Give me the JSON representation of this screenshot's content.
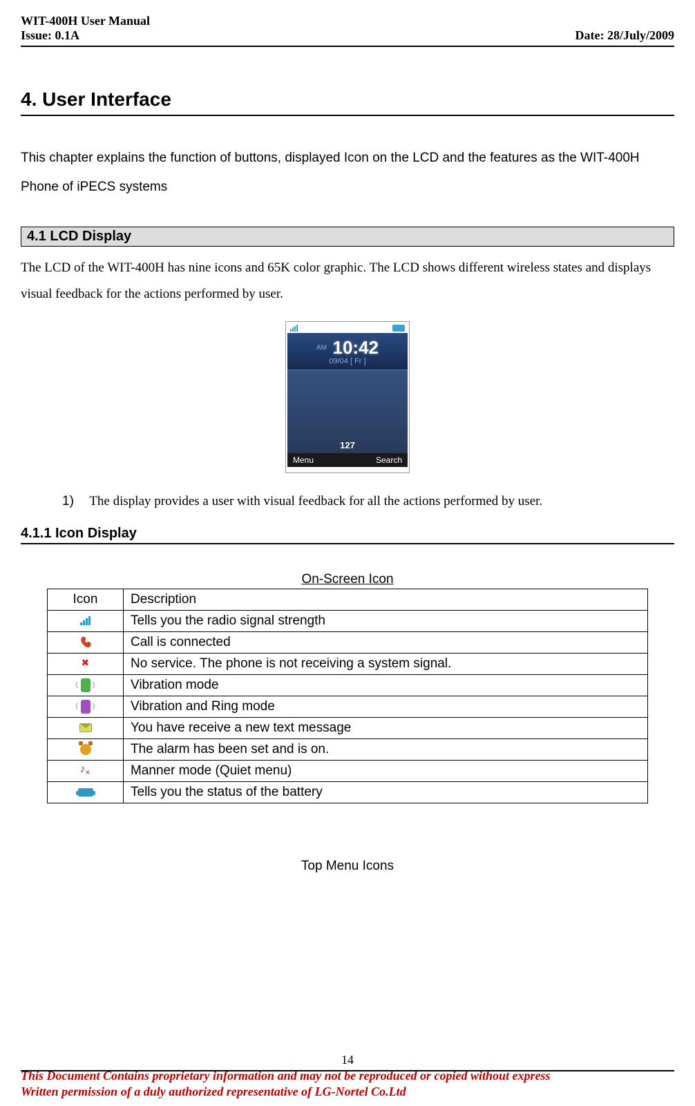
{
  "header": {
    "title": "WIT-400H User Manual",
    "issue": "Issue: 0.1A",
    "date": "Date: 28/July/2009"
  },
  "chapter": {
    "number_title": "4.       User Interface",
    "intro": "This chapter explains the function of buttons, displayed Icon on the LCD and the features as the WIT-400H Phone of iPECS systems"
  },
  "section41": {
    "title": "4.1         LCD Display",
    "text": "The LCD of the WIT-400H has nine icons and 65K color graphic. The LCD shows different wireless states and displays visual feedback for the actions performed by user."
  },
  "phone_screen": {
    "am": "AM",
    "time": "10:42",
    "date": "09/04 [ Fr ]",
    "station": "127",
    "softkey_left": "Menu",
    "softkey_right": "Search"
  },
  "list_item_1": {
    "num": "1)",
    "text": "The display provides a user with visual feedback for all the actions performed by user."
  },
  "section411": {
    "title": "4.1.1     Icon Display"
  },
  "table1": {
    "caption": "On-Screen Icon",
    "headers": {
      "icon": "Icon",
      "desc": "Description"
    },
    "rows": [
      {
        "desc": "Tells you the radio signal strength",
        "icon": "signal-icon"
      },
      {
        "desc": "Call is connected",
        "icon": "call-icon"
      },
      {
        "desc": "No service. The phone is not receiving a system signal.",
        "icon": "no-service-icon"
      },
      {
        "desc": "Vibration mode",
        "icon": "vibration-icon"
      },
      {
        "desc": "Vibration and Ring mode",
        "icon": "vibration-ring-icon"
      },
      {
        "desc": "You have receive a new text message",
        "icon": "message-icon"
      },
      {
        "desc": "The alarm has been set and is on.",
        "icon": "alarm-icon"
      },
      {
        "desc": "Manner mode (Quiet menu)",
        "icon": "manner-icon"
      },
      {
        "desc": "Tells you the status of the battery",
        "icon": "battery-icon"
      }
    ]
  },
  "table2_caption": "Top Menu Icons",
  "page_number": "14",
  "footer": {
    "line1": "This Document Contains proprietary information and may not be reproduced or copied without express",
    "line2": "Written permission of a duly authorized representative of LG-Nortel Co.Ltd"
  }
}
